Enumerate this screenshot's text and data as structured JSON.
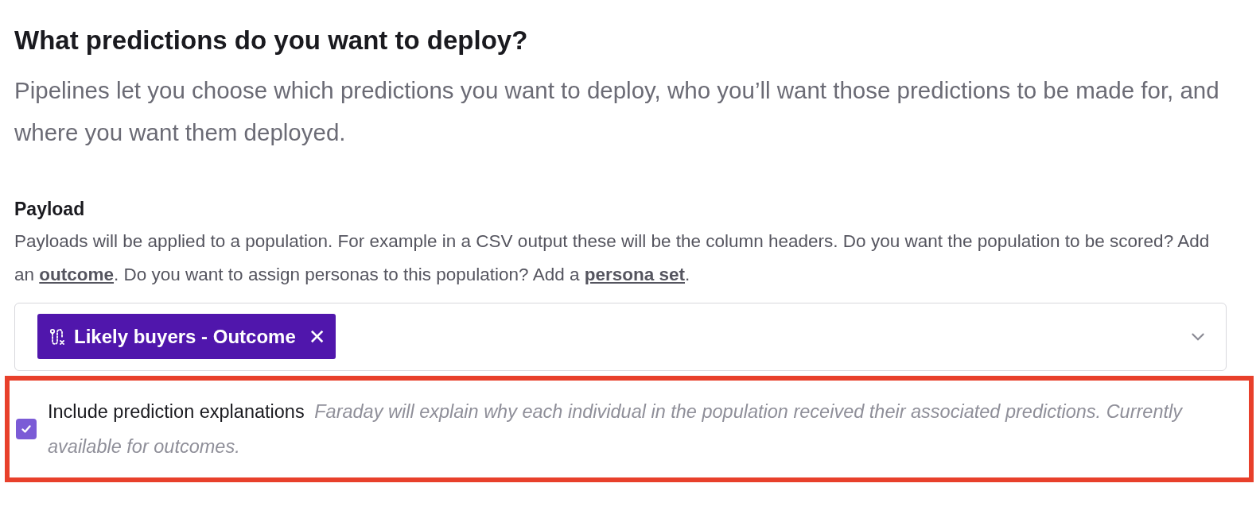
{
  "heading": "What predictions do you want to deploy?",
  "subtitle": "Pipelines let you choose which predictions you want to deploy, who you’ll want those predictions to be made for, and where you want them deployed.",
  "payload": {
    "title": "Payload",
    "description": [
      {
        "kind": "text",
        "text": "Payloads will be applied to a population. For example in a CSV output these will be the column headers. Do you want the population to be scored? Add an "
      },
      {
        "kind": "link",
        "text": "outcome"
      },
      {
        "kind": "text",
        "text": ". Do you want to assign personas to this population? Add a "
      },
      {
        "kind": "link",
        "text": "persona set"
      },
      {
        "kind": "text",
        "text": "."
      }
    ],
    "select": {
      "tags": [
        {
          "label": "Likely buyers - Outcome",
          "close": "✕"
        }
      ],
      "expanded": false
    }
  },
  "explanations": {
    "checked": true,
    "label": "Include prediction explanations",
    "hint": "Faraday will explain why each individual in the population received their associated predictions. Currently available for outcomes."
  }
}
